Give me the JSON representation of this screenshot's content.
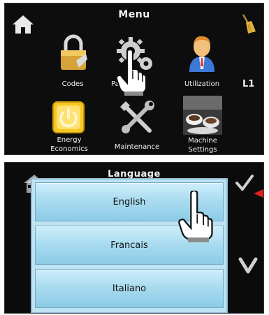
{
  "menu_screen": {
    "title": "Menu",
    "level_indicator": "L1",
    "tiles": [
      {
        "label": "Codes",
        "icon": "padlock-icon"
      },
      {
        "label": "Parameters",
        "icon": "gears-icon"
      },
      {
        "label": "Utilization",
        "icon": "user-icon"
      },
      {
        "label": "Energy Economics",
        "icon": "power-icon"
      },
      {
        "label": "Maintenance",
        "icon": "tools-icon"
      },
      {
        "label": "Machine Settings",
        "icon": "coffee-cups-icon"
      }
    ],
    "visible_labels": {
      "codes": "Codes",
      "parameters": "Pa          ers",
      "utilization": "Utilization",
      "energy_line1": "Energy",
      "energy_line2": "Economics",
      "maintenance": "Maintenance",
      "machine_line1": "Machine",
      "machine_line2": "Settings"
    }
  },
  "language_screen": {
    "title": "Language",
    "options": [
      "English",
      "Francais",
      "Italiano"
    ]
  },
  "colors": {
    "screen_bg": "#0d0d0d",
    "button_blue": "#aadcf0",
    "accent_red": "#e02020"
  }
}
